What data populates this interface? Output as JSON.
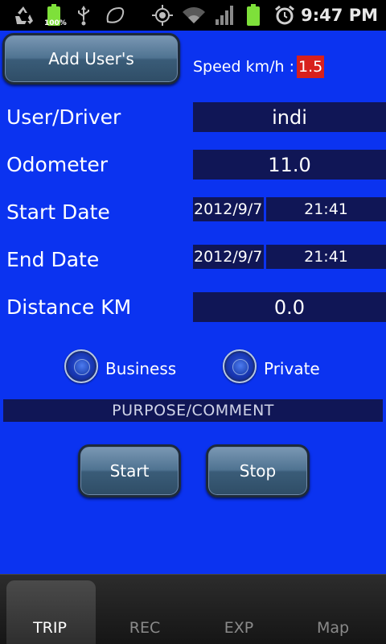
{
  "status_bar": {
    "time": "9:47 PM",
    "battery_percent": "100%",
    "icons": [
      "recycle-icon",
      "battery-icon",
      "usb-icon",
      "leaf-icon",
      "gps-icon",
      "wifi-icon",
      "signal-icon",
      "battery-icon",
      "alarm-icon"
    ]
  },
  "form": {
    "add_users_label": "Add User's",
    "speed_label": "Speed km/h :",
    "speed_value": "1.5",
    "user_driver_label": "User/Driver",
    "user_driver_value": "indi",
    "odometer_label": "Odometer",
    "odometer_value": "11.0",
    "start_date_label": "Start Date",
    "start_date_value": "2012/9/7",
    "start_time_value": "21:41",
    "end_date_label": "End Date",
    "end_date_value": "2012/9/7",
    "end_time_value": "21:41",
    "distance_label": "Distance KM",
    "distance_value": "0.0",
    "business_label": "Business",
    "private_label": "Private",
    "purpose_label": "PURPOSE/COMMENT",
    "start_label": "Start",
    "stop_label": "Stop"
  },
  "tabs": [
    {
      "label": "TRIP",
      "active": true
    },
    {
      "label": "REC",
      "active": false
    },
    {
      "label": "EXP",
      "active": false
    },
    {
      "label": "Map",
      "active": false
    }
  ],
  "colors": {
    "background": "#0b33f0",
    "field": "#101656",
    "speed_highlight": "#d8201c"
  }
}
